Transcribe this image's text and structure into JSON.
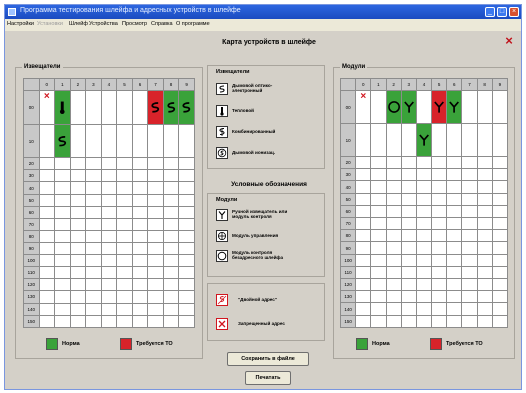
{
  "window": {
    "title": "Программа тестирования шлейфа и адресных устройств в шлейфе",
    "controls": [
      "_",
      "□",
      "×"
    ]
  },
  "menu": [
    {
      "label": "Настройки",
      "enabled": true
    },
    {
      "label": "Установки",
      "enabled": false
    },
    {
      "label": "Шлейф",
      "enabled": true
    },
    {
      "label": "Устройства",
      "enabled": true
    },
    {
      "label": "Просмотр",
      "enabled": true
    },
    {
      "label": "Справка",
      "enabled": true
    },
    {
      "label": "О программе",
      "enabled": true
    }
  ],
  "page_title": "Карта устройств в шлейфе",
  "close_glyph": "×",
  "sensors_grid": {
    "label": "Извещатели",
    "col_headers": [
      "0",
      "1",
      "2",
      "3",
      "4",
      "5",
      "6",
      "7",
      "8",
      "9"
    ],
    "row_headers": [
      "00",
      "10",
      "20",
      "30",
      "40",
      "50",
      "60",
      "70",
      "80",
      "90",
      "100",
      "110",
      "120",
      "130",
      "140",
      "150"
    ],
    "cells": [
      {
        "row": 0,
        "col": 0,
        "kind": "forbidden"
      },
      {
        "row": 0,
        "col": 1,
        "kind": "thermal",
        "state": "normal"
      },
      {
        "row": 0,
        "col": 7,
        "kind": "smoke",
        "state": "service"
      },
      {
        "row": 0,
        "col": 8,
        "kind": "smoke",
        "state": "normal"
      },
      {
        "row": 0,
        "col": 9,
        "kind": "smoke",
        "state": "normal"
      },
      {
        "row": 1,
        "col": 1,
        "kind": "smoke",
        "state": "normal"
      }
    ],
    "status_normal": "Норма",
    "status_service": "Требуется ТО"
  },
  "modules_grid": {
    "label": "Модули",
    "col_headers": [
      "0",
      "1",
      "2",
      "3",
      "4",
      "5",
      "6",
      "7",
      "8",
      "9"
    ],
    "row_headers": [
      "00",
      "10",
      "20",
      "30",
      "40",
      "50",
      "60",
      "70",
      "80",
      "90",
      "100",
      "110",
      "120",
      "130",
      "140",
      "150"
    ],
    "cells": [
      {
        "row": 0,
        "col": 0,
        "kind": "forbidden"
      },
      {
        "row": 0,
        "col": 2,
        "kind": "loop-control",
        "state": "normal"
      },
      {
        "row": 0,
        "col": 3,
        "kind": "manual",
        "state": "normal"
      },
      {
        "row": 0,
        "col": 5,
        "kind": "manual",
        "state": "service"
      },
      {
        "row": 0,
        "col": 6,
        "kind": "manual",
        "state": "normal"
      },
      {
        "row": 1,
        "col": 4,
        "kind": "manual",
        "state": "normal"
      }
    ],
    "status_normal": "Норма",
    "status_service": "Требуется ТО"
  },
  "legend": {
    "sensors_head": "Извещатели",
    "sensors": [
      {
        "icon": "smoke",
        "text": "Дымовой оптико-электронный"
      },
      {
        "icon": "thermal",
        "text": "Тепловой"
      },
      {
        "icon": "combined",
        "text": "Комбинированный"
      },
      {
        "icon": "ionization",
        "text": "Дымовой ионизац."
      }
    ],
    "section_head": "Условные обозначения",
    "modules_head": "Модули",
    "modules": [
      {
        "icon": "manual",
        "text": "Ручной извещатель или модуль контроля"
      },
      {
        "icon": "control",
        "text": "Модуль управления"
      },
      {
        "icon": "loop-control",
        "text": "Модуль контроля безадресного шлейфа"
      }
    ],
    "special": [
      {
        "icon": "double-address",
        "text": "\"Двойной адрес\""
      },
      {
        "icon": "forbidden",
        "text": "Запрещенный адрес"
      }
    ]
  },
  "buttons": {
    "save": "Сохранить в файле",
    "print": "Печатать"
  },
  "colors": {
    "normal": "#3aa23a",
    "service": "#d8232a",
    "forbidden": "#d1161f",
    "titlebar": "#2d66e0"
  }
}
